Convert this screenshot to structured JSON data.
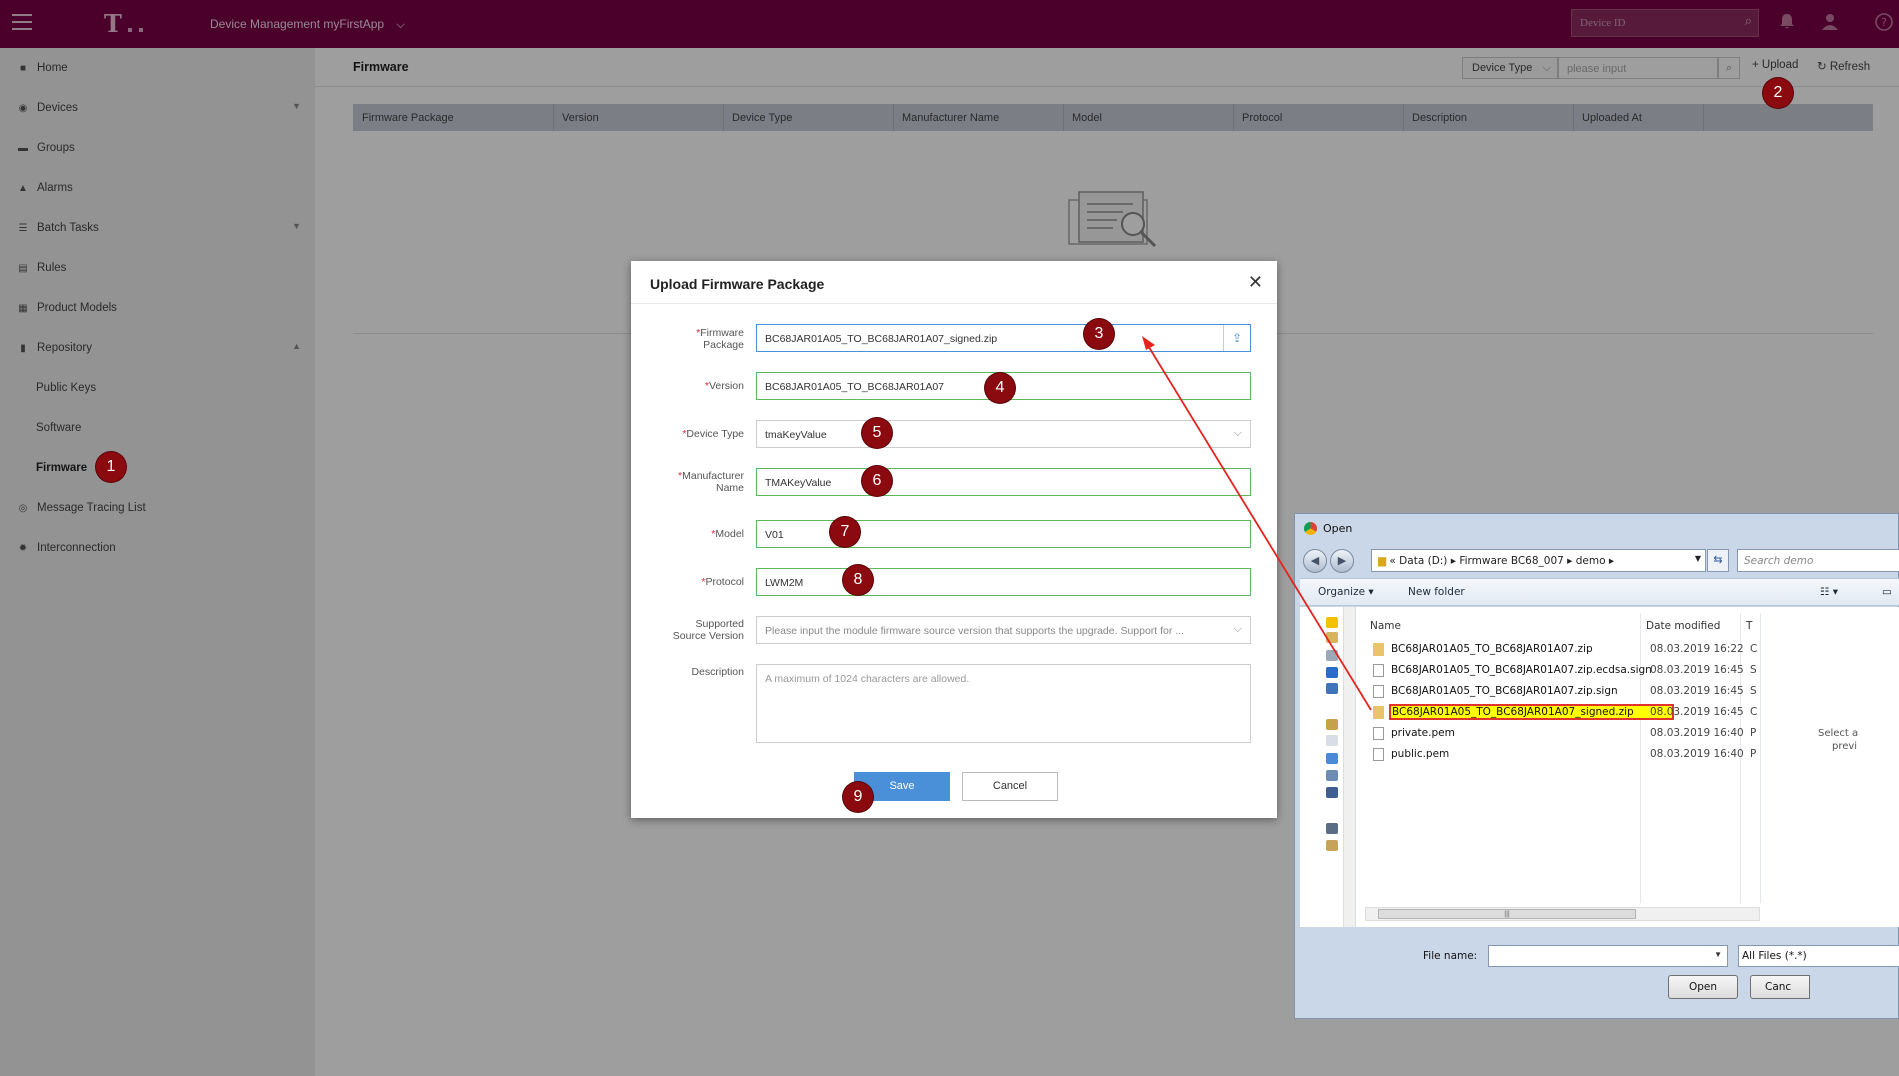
{
  "topbar": {
    "app_title": "Device Management  myFirstApp",
    "device_search_placeholder": "Device ID",
    "colors": {
      "bar": "#7a0047",
      "accent": "#e20074"
    }
  },
  "sidebar": {
    "items": [
      {
        "label": "Home",
        "icon": "home-icon"
      },
      {
        "label": "Devices",
        "icon": "devices-icon"
      },
      {
        "label": "Groups",
        "icon": "folder-icon"
      },
      {
        "label": "Alarms",
        "icon": "bell-icon"
      },
      {
        "label": "Batch Tasks",
        "icon": "list-icon"
      },
      {
        "label": "Rules",
        "icon": "rules-icon"
      },
      {
        "label": "Product Models",
        "icon": "grid-icon"
      },
      {
        "label": "Repository",
        "icon": "repository-icon"
      },
      {
        "label": "Public Keys"
      },
      {
        "label": "Software"
      },
      {
        "label": "Firmware"
      },
      {
        "label": "Message Tracing List",
        "icon": "trace-icon"
      },
      {
        "label": "Interconnection",
        "icon": "gear-icon"
      }
    ]
  },
  "page": {
    "title": "Firmware",
    "device_type_select": "Device Type",
    "search_placeholder": "please input",
    "upload_label": "Upload",
    "refresh_label": "Refresh",
    "columns": [
      "Firmware Package",
      "Version",
      "Device Type",
      "Manufacturer Name",
      "Model",
      "Protocol",
      "Description",
      "Uploaded At"
    ]
  },
  "modal": {
    "title": "Upload Firmware Package",
    "fields": {
      "firmware_package": {
        "label_1": "Firmware",
        "label_2": "Package",
        "value": "BC68JAR01A05_TO_BC68JAR01A07_signed.zip"
      },
      "version": {
        "label": "Version",
        "value": "BC68JAR01A05_TO_BC68JAR01A07"
      },
      "device_type": {
        "label": "Device Type",
        "value": "tmaKeyValue"
      },
      "manufacturer": {
        "label_1": "Manufacturer",
        "label_2": "Name",
        "value": "TMAKeyValue"
      },
      "model": {
        "label": "Model",
        "value": "V01"
      },
      "protocol": {
        "label": "Protocol",
        "value": "LWM2M"
      },
      "source_version": {
        "label_1": "Supported",
        "label_2": "Source Version",
        "placeholder": "Please input the module firmware source version that supports the upgrade. Support for ..."
      },
      "description": {
        "label": "Description",
        "placeholder": "A maximum of 1024 characters are allowed."
      }
    },
    "save_label": "Save",
    "cancel_label": "Cancel"
  },
  "badges": [
    "1",
    "2",
    "3",
    "4",
    "5",
    "6",
    "7",
    "8",
    "9"
  ],
  "file_dialog": {
    "title": "Open",
    "address": "«  Data (D:)  ▸  Firmware BC68_007  ▸  demo  ▸",
    "search_placeholder": "Search demo",
    "organize_label": "Organize ▾",
    "new_folder_label": "New folder",
    "columns": {
      "name": "Name",
      "date": "Date modified",
      "type": "T"
    },
    "files": [
      {
        "name": "BC68JAR01A05_TO_BC68JAR01A07.zip",
        "date": "08.03.2019 16:22",
        "type": "C",
        "kind": "zip"
      },
      {
        "name": "BC68JAR01A05_TO_BC68JAR01A07.zip.ecdsa.sign",
        "date": "08.03.2019 16:45",
        "type": "S",
        "kind": "file"
      },
      {
        "name": "BC68JAR01A05_TO_BC68JAR01A07.zip.sign",
        "date": "08.03.2019 16:45",
        "type": "S",
        "kind": "file"
      },
      {
        "name": "BC68JAR01A05_TO_BC68JAR01A07_signed.zip",
        "date": "08.03.2019 16:45",
        "type": "C",
        "kind": "zip"
      },
      {
        "name": "private.pem",
        "date": "08.03.2019 16:40",
        "type": "P",
        "kind": "file"
      },
      {
        "name": "public.pem",
        "date": "08.03.2019 16:40",
        "type": "P",
        "kind": "file"
      }
    ],
    "preview_1": "Select a",
    "preview_2": "previ",
    "file_name_label": "File name:",
    "file_type": "All Files (*.*)",
    "open_label": "Open",
    "cancel_label": "Canc"
  }
}
